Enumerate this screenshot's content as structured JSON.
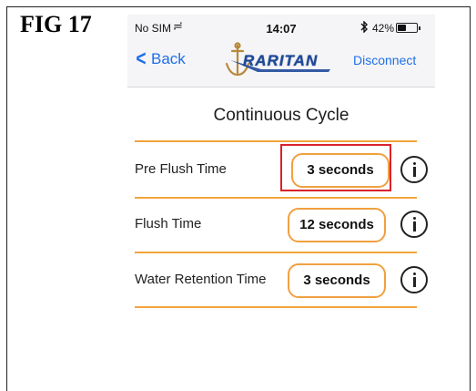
{
  "figure": {
    "label": "FIG 17"
  },
  "status_bar": {
    "carrier": "No SIM",
    "time": "14:07",
    "battery_percent": "42%",
    "battery_level": 0.42
  },
  "nav": {
    "back_label": "Back",
    "logo_text": "RARITAN",
    "disconnect_label": "Disconnect"
  },
  "page": {
    "title": "Continuous Cycle"
  },
  "settings": [
    {
      "label": "Pre Flush Time",
      "value": "3 seconds",
      "highlighted": true
    },
    {
      "label": "Flush Time",
      "value": "12 seconds",
      "highlighted": false
    },
    {
      "label": "Water Retention Time",
      "value": "3 seconds",
      "highlighted": false
    }
  ],
  "colors": {
    "accent": "#f0a040",
    "link": "#1f6fe8",
    "highlight_box": "#d9222a",
    "logo": "#1e4a9a"
  },
  "icons": {
    "back": "chevron-left-icon",
    "wifi": "wifi-icon",
    "bluetooth": "bluetooth-icon",
    "battery": "battery-icon",
    "info": "info-icon",
    "logo": "anchor-icon"
  }
}
